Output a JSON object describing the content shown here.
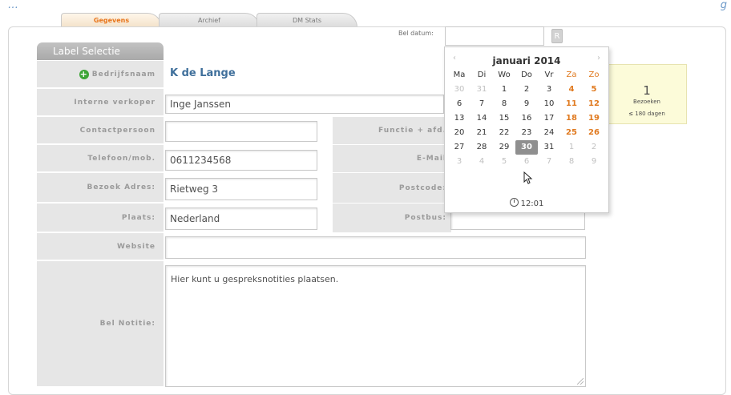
{
  "top": {
    "left_text": "…",
    "right_text": "g"
  },
  "tabs": [
    {
      "label": "Gegevens",
      "active": true
    },
    {
      "label": "Archief",
      "active": false
    },
    {
      "label": "DM Stats",
      "active": false
    }
  ],
  "label_selectie": "Label Selectie",
  "bel_datum": {
    "label": "Bel datum:",
    "value": "",
    "reset_label": "R"
  },
  "bedrijfsnaam": {
    "label": "Bedrijfsnaam",
    "value": "K de Lange",
    "icon": "plus-circle-icon"
  },
  "fields": {
    "interne_verkoper": {
      "label": "Interne verkoper",
      "value": "Inge Janssen"
    },
    "contactpersoon": {
      "label": "Contactpersoon",
      "value": ""
    },
    "functie": {
      "label": "Functie + afd.",
      "value": ""
    },
    "telefoon": {
      "label": "Telefoon/mob.",
      "value": "0611234568"
    },
    "email": {
      "label": "E-Mail",
      "value": ""
    },
    "bezoek_adres": {
      "label": "Bezoek Adres:",
      "value": "Rietweg 3"
    },
    "postcode": {
      "label": "Postcode:",
      "value": ""
    },
    "plaats": {
      "label": "Plaats:",
      "value": "Nederland"
    },
    "postbus": {
      "label": "Postbus:",
      "value": ""
    },
    "website": {
      "label": "Website",
      "value": ""
    },
    "bel_notitie": {
      "label": "Bel Notitie:",
      "value": "Hier kunt u gespreksnotities plaatsen."
    }
  },
  "visits": {
    "count": "1",
    "label": "Bezoeken",
    "period": "≤ 180 dagen"
  },
  "calendar": {
    "title": "januari 2014",
    "prev": "‹",
    "next": "›",
    "weekdays": [
      "Ma",
      "Di",
      "Wo",
      "Do",
      "Vr",
      "Za",
      "Zo"
    ],
    "weeks": [
      [
        "30",
        "31",
        "1",
        "2",
        "3",
        "4",
        "5"
      ],
      [
        "6",
        "7",
        "8",
        "9",
        "10",
        "11",
        "12"
      ],
      [
        "13",
        "14",
        "15",
        "16",
        "17",
        "18",
        "19"
      ],
      [
        "20",
        "21",
        "22",
        "23",
        "24",
        "25",
        "26"
      ],
      [
        "27",
        "28",
        "29",
        "30",
        "31",
        "1",
        "2"
      ],
      [
        "3",
        "4",
        "5",
        "6",
        "7",
        "8",
        "9"
      ]
    ],
    "selected": "30",
    "time": "12:01"
  },
  "colors": {
    "accent_orange": "#e8751a",
    "label_bg": "#e6e6e6",
    "name_blue": "#3f6f9b",
    "visits_bg": "#fcfbd9"
  }
}
